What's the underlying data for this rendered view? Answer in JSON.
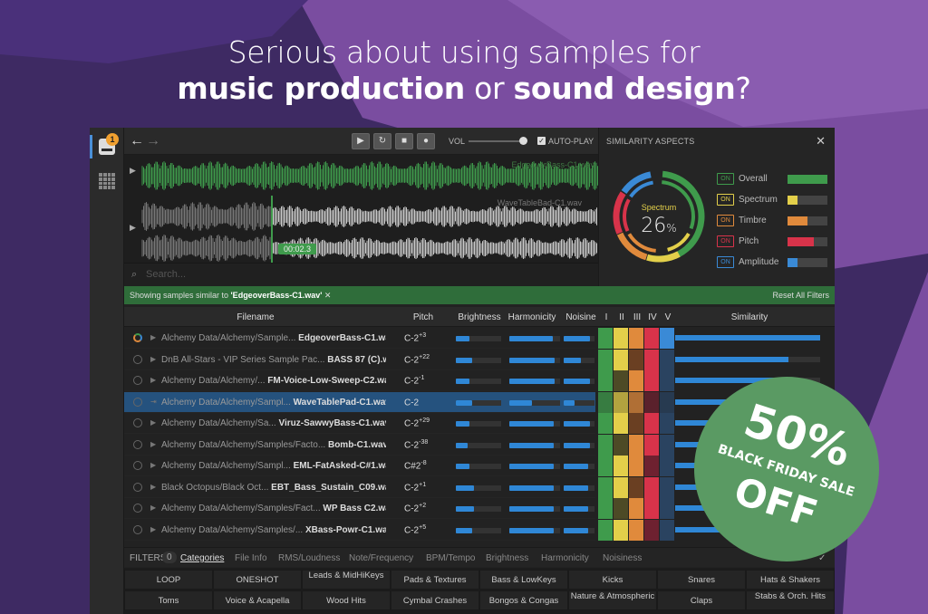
{
  "headline": {
    "line1": "Serious about using samples for",
    "bold1": "music production",
    "mid": " or ",
    "bold2": "sound design",
    "end": "?"
  },
  "colors": {
    "background": "#3e2a63",
    "accent_green": "#3f9b4c",
    "accent_blue": "#2f87d6",
    "selected_row": "#25527e",
    "sale_circle": "#5a9a63"
  },
  "sidebar": {
    "badge_count": "1",
    "icons": [
      "drive-icon",
      "grid-icon"
    ]
  },
  "toolbar": {
    "back": "←",
    "forward": "→",
    "play": "▶",
    "loop": "↻",
    "stop": "■",
    "record": "●",
    "vol_label": "VOL",
    "volume": 0.9,
    "autoplay_check": "✓",
    "autoplay_label": "AUTO-PLAY"
  },
  "waveform": {
    "top_file": "EdgeoverBass-C1.wav",
    "bottom_file": "WaveTableBad-C1.wav",
    "time": "00:02.3"
  },
  "search": {
    "icon": "search-icon",
    "placeholder": "Search..."
  },
  "similarity_panel": {
    "title": "SIMILARITY ASPECTS",
    "close": "✕",
    "gauge_label": "Spectrum",
    "gauge_value": "26",
    "gauge_unit": "%",
    "aspects": [
      {
        "on": "ON",
        "label": "Overall",
        "color": "#3f9b4c",
        "level": 1.0
      },
      {
        "on": "ON",
        "label": "Spectrum",
        "color": "#e3cf4a",
        "level": 0.25
      },
      {
        "on": "ON",
        "label": "Timbre",
        "color": "#e08a3c",
        "level": 0.5
      },
      {
        "on": "ON",
        "label": "Pitch",
        "color": "#d8334a",
        "level": 0.65
      },
      {
        "on": "ON",
        "label": "Amplitude",
        "color": "#3a8ad6",
        "level": 0.25
      }
    ]
  },
  "filterbar": {
    "prefix": "Showing samples similar to ",
    "file": "'EdgeoverBass-C1.wav'",
    "clear": "✕",
    "reset": "Reset All Filters"
  },
  "table": {
    "headers": {
      "filename": "Filename",
      "pitch": "Pitch",
      "brightness": "Brightness",
      "harmonicity": "Harmonicity",
      "noisiness": "Noisine",
      "i": "I",
      "ii": "II",
      "iii": "III",
      "iv": "IV",
      "v": "V",
      "similarity": "Similarity"
    },
    "rows": [
      {
        "path": "Alchemy Data/Alchemy/Sample...",
        "file": "EdgeoverBass-C1.wav",
        "note": "C-2",
        "sup": "+3",
        "b": 0.3,
        "h": 0.85,
        "n": 0.85,
        "sim": 1.0
      },
      {
        "path": "DnB All-Stars - VIP Series Sample Pac...",
        "file": "BASS 87 (C).wav",
        "note": "C-2",
        "sup": "+22",
        "b": 0.35,
        "h": 0.9,
        "n": 0.55,
        "sim": 0.78
      },
      {
        "path": "Alchemy Data/Alchemy/...",
        "file": "FM-Voice-Low-Sweep-C2.wav",
        "note": "C-2",
        "sup": "-1",
        "b": 0.3,
        "h": 0.9,
        "n": 0.85,
        "sim": 0.76
      },
      {
        "path": "Alchemy Data/Alchemy/Sampl...",
        "file": "WaveTablePad-C1.wav",
        "note": "C-2",
        "sup": "",
        "b": 0.35,
        "h": 0.45,
        "n": 0.35,
        "sim": 0.75
      },
      {
        "path": "Alchemy Data/Alchemy/Sa...",
        "file": "Viruz-SawwyBass-C1.wav",
        "note": "C-2",
        "sup": "+29",
        "b": 0.3,
        "h": 0.88,
        "n": 0.85,
        "sim": 0.65
      },
      {
        "path": "Alchemy Data/Alchemy/Samples/Facto...",
        "file": "Bomb-C1.wav",
        "note": "C-2",
        "sup": "-38",
        "b": 0.25,
        "h": 0.88,
        "n": 0.85,
        "sim": 0.6
      },
      {
        "path": "Alchemy Data/Alchemy/Sampl...",
        "file": "EML-FatAsked-C#1.wav",
        "note": "C#2",
        "sup": "-8",
        "b": 0.3,
        "h": 0.88,
        "n": 0.8,
        "sim": 0.55
      },
      {
        "path": "Black Octopus/Black Oct...",
        "file": "EBT_Bass_Sustain_C09.wav",
        "note": "C-2",
        "sup": "+1",
        "b": 0.4,
        "h": 0.88,
        "n": 0.8,
        "sim": 0.5
      },
      {
        "path": "Alchemy Data/Alchemy/Samples/Fact...",
        "file": "WP Bass C2.wav",
        "note": "C-2",
        "sup": "+2",
        "b": 0.4,
        "h": 0.88,
        "n": 0.8,
        "sim": 0.45
      },
      {
        "path": "Alchemy Data/Alchemy/Samples/...",
        "file": "XBass-Powr-C1.wav",
        "note": "C-2",
        "sup": "+5",
        "b": 0.35,
        "h": 0.88,
        "n": 0.8,
        "sim": 0.4
      }
    ]
  },
  "filter_tabs": {
    "label": "FILTERS",
    "count": "0",
    "items": [
      "Categories",
      "File Info",
      "RMS/Loudness",
      "Note/Frequency",
      "BPM/Tempo",
      "Brightness",
      "Harmonicity",
      "Noisiness"
    ]
  },
  "categories": {
    "row1": [
      "LOOP",
      "ONESHOT",
      "Leads & MidHiKeys",
      "Pads & Textures",
      "Bass & LowKeys",
      "Kicks",
      "Snares",
      "Hats & Shakers"
    ],
    "row2": [
      "Toms",
      "Voice & Acapella",
      "Wood Hits",
      "Cymbal Crashes",
      "Bongos & Congas",
      "Nature & Atmospheric",
      "Claps",
      "Stabs & Orch. Hits"
    ]
  },
  "sale": {
    "percent": "50%",
    "label": "BLACK FRIDAY SALE",
    "off": "OFF"
  }
}
